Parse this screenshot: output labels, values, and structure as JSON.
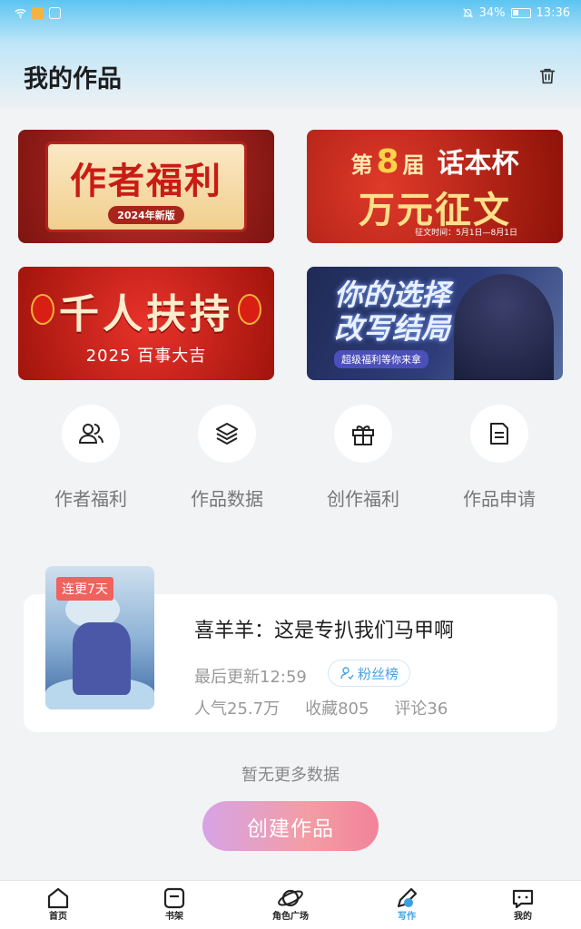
{
  "status_bar": {
    "battery": "34%",
    "time": "13:36"
  },
  "header": {
    "title": "我的作品"
  },
  "banners": [
    {
      "title": "作者福利",
      "subtitle": "2024年新版"
    },
    {
      "prefix": "第",
      "number": "8",
      "suffix": "届",
      "name": "话本杯",
      "main": "万元征文",
      "note": "征文时间：5月1日—8月1日"
    },
    {
      "title": "千人扶持",
      "subtitle": "2025 百事大吉"
    },
    {
      "title_line1": "你的选择",
      "title_line2": "改写结局",
      "subtitle": "超级福利等你来拿"
    }
  ],
  "shortcuts": [
    {
      "label": "作者福利",
      "icon": "users-icon"
    },
    {
      "label": "作品数据",
      "icon": "layers-icon"
    },
    {
      "label": "创作福利",
      "icon": "gift-icon"
    },
    {
      "label": "作品申请",
      "icon": "document-icon"
    }
  ],
  "work": {
    "badge": "连更7天",
    "title": "喜羊羊：这是专扒我们马甲啊",
    "update": "最后更新12:59",
    "fans_button": "粉丝榜",
    "popularity": "人气25.7万",
    "favorites": "收藏805",
    "comments": "评论36"
  },
  "empty_text": "暂无更多数据",
  "create_button": "创建作品",
  "tabbar": [
    {
      "label": "首页",
      "icon": "home-icon"
    },
    {
      "label": "书架",
      "icon": "bookshelf-icon"
    },
    {
      "label": "角色广场",
      "icon": "planet-icon"
    },
    {
      "label": "写作",
      "icon": "pen-icon",
      "active": true
    },
    {
      "label": "我的",
      "icon": "chat-icon"
    }
  ],
  "colors": {
    "accent": "#3aa0e0",
    "create_start": "#d7a3e6",
    "create_end": "#f2839a",
    "badge": "#f0625e"
  }
}
